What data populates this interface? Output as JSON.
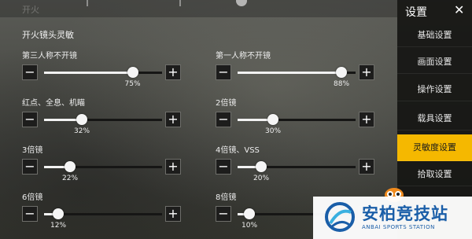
{
  "header_ghost": "开火",
  "section_title": "开火镜头灵敏",
  "sliders": [
    {
      "label": "第三人称不开镜",
      "percent": "75%",
      "value": 75
    },
    {
      "label": "第一人称不开镜",
      "percent": "88%",
      "value": 88
    },
    {
      "label": "红点、全息、机瞄",
      "percent": "32%",
      "value": 32
    },
    {
      "label": "2倍镜",
      "percent": "30%",
      "value": 30
    },
    {
      "label": "3倍镜",
      "percent": "22%",
      "value": 22
    },
    {
      "label": "4倍镜、VSS",
      "percent": "20%",
      "value": 20
    },
    {
      "label": "6倍镜",
      "percent": "12%",
      "value": 12
    },
    {
      "label": "8倍镜",
      "percent": "10%",
      "value": 10
    }
  ],
  "buttons": {
    "minus": "−",
    "plus": "+"
  },
  "sidebar": {
    "title": "设置",
    "close": "✕",
    "items": [
      {
        "label": "基础设置",
        "active": false
      },
      {
        "label": "画面设置",
        "active": false
      },
      {
        "label": "操作设置",
        "active": false
      },
      {
        "label": "载具设置",
        "active": false
      },
      {
        "label": "灵敏度设置",
        "active": true
      },
      {
        "label": "拾取设置",
        "active": false
      }
    ]
  },
  "watermark": {
    "title": "安柏竞技站",
    "subtitle": "ANBAI SPORTS STATION"
  },
  "colors": {
    "accent": "#f5b800",
    "watermark": "#1a5ea8",
    "panel": "#161614"
  }
}
